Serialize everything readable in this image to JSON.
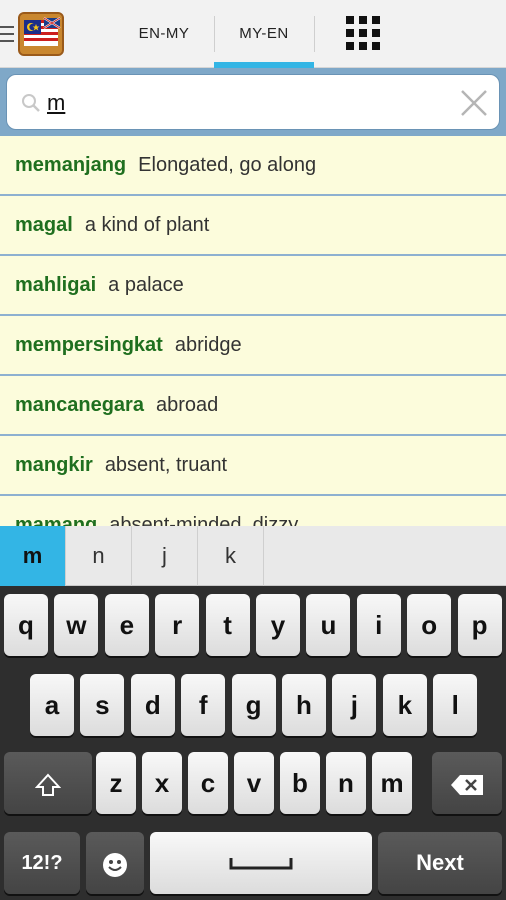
{
  "header": {
    "tabs": [
      {
        "label": "EN-MY",
        "active": false
      },
      {
        "label": "MY-EN",
        "active": true
      }
    ],
    "accent_color": "#33b5e5"
  },
  "search": {
    "value": "m",
    "placeholder": ""
  },
  "results": [
    {
      "word": "memanjang",
      "definition": "Elongated, go along"
    },
    {
      "word": "magal",
      "definition": "a kind of plant"
    },
    {
      "word": "mahligai",
      "definition": "a palace"
    },
    {
      "word": "mempersingkat",
      "definition": "abridge"
    },
    {
      "word": "mancanegara",
      "definition": "abroad"
    },
    {
      "word": "mangkir",
      "definition": "absent, truant"
    },
    {
      "word": "mamang",
      "definition": "absent-minded, dizzy"
    }
  ],
  "suggestions": [
    "m",
    "n",
    "j",
    "k"
  ],
  "keyboard": {
    "row1": [
      "q",
      "w",
      "e",
      "r",
      "t",
      "y",
      "u",
      "i",
      "o",
      "p"
    ],
    "row2": [
      "a",
      "s",
      "d",
      "f",
      "g",
      "h",
      "j",
      "k",
      "l"
    ],
    "row3": [
      "z",
      "x",
      "c",
      "v",
      "b",
      "n",
      "m"
    ],
    "symbols_label": "12!?",
    "next_label": "Next"
  }
}
